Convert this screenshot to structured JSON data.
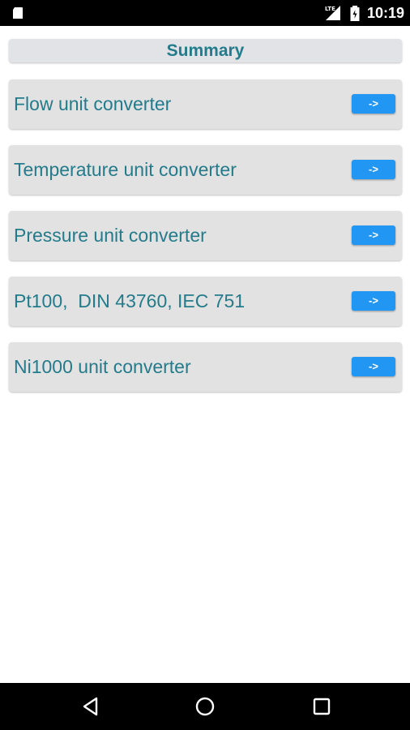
{
  "status_bar": {
    "time": "10:19",
    "network": "LTE",
    "icons": [
      "sd-card-icon",
      "lte-signal-icon",
      "battery-icon"
    ]
  },
  "header": {
    "title": "Summary"
  },
  "converters": [
    {
      "label": "Flow unit converter",
      "button": "->"
    },
    {
      "label": "Temperature unit converter",
      "button": "->"
    },
    {
      "label": "Pressure unit converter",
      "button": "->"
    },
    {
      "label": "Pt100,  DIN 43760, IEC 751",
      "button": "->"
    },
    {
      "label": "Ni1000 unit converter",
      "button": "->"
    }
  ],
  "nav_bar": {
    "icons": [
      "back-icon",
      "home-icon",
      "recents-icon"
    ]
  },
  "colors": {
    "accent_text": "#237b8b",
    "button": "#2196f3",
    "card": "#e2e2e2",
    "header_bg": "#e1e3e6"
  }
}
